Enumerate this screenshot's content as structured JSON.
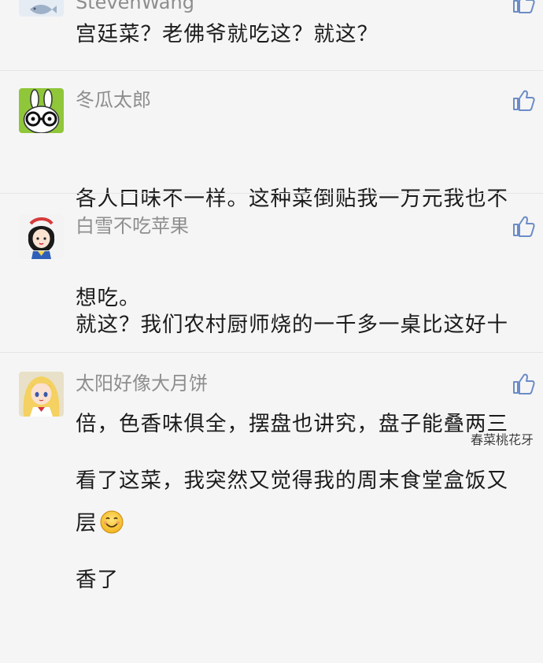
{
  "comments": [
    {
      "username": "StevenWang",
      "text": "宫廷菜？老佛爷就吃这？就这？",
      "avatar_icon": "fish-avatar-icon"
    },
    {
      "username": "冬瓜太郎",
      "text": "各人口味不一样。这种菜倒贴我一万元我也不想吃。",
      "line1": "各人口味不一样。这种菜倒贴我一万元我也不",
      "line2": "想吃。",
      "avatar_icon": "bunny-glasses-avatar-icon"
    },
    {
      "username": "白雪不吃苹果",
      "line1": "就这？我们农村厨师烧的一千多一桌比这好十",
      "line2": "倍，色香味俱全，摆盘也讲究，盘子能叠两三",
      "line3": "层",
      "emoji": "smile-emoji-icon",
      "avatar_icon": "snow-white-avatar-icon"
    },
    {
      "username": "太阳好像大月饼",
      "line1": "看了这菜，我突然又觉得我的周末食堂盒饭又",
      "line2": "香了",
      "avatar_icon": "sailor-moon-avatar-icon"
    }
  ],
  "like_icon": "thumbs-up-icon",
  "watermark": "春菜桃花牙",
  "colors": {
    "background": "#f5f5f5",
    "username": "#8e8e8e",
    "text": "#1b1b1b",
    "icon": "#6b8cc7"
  }
}
